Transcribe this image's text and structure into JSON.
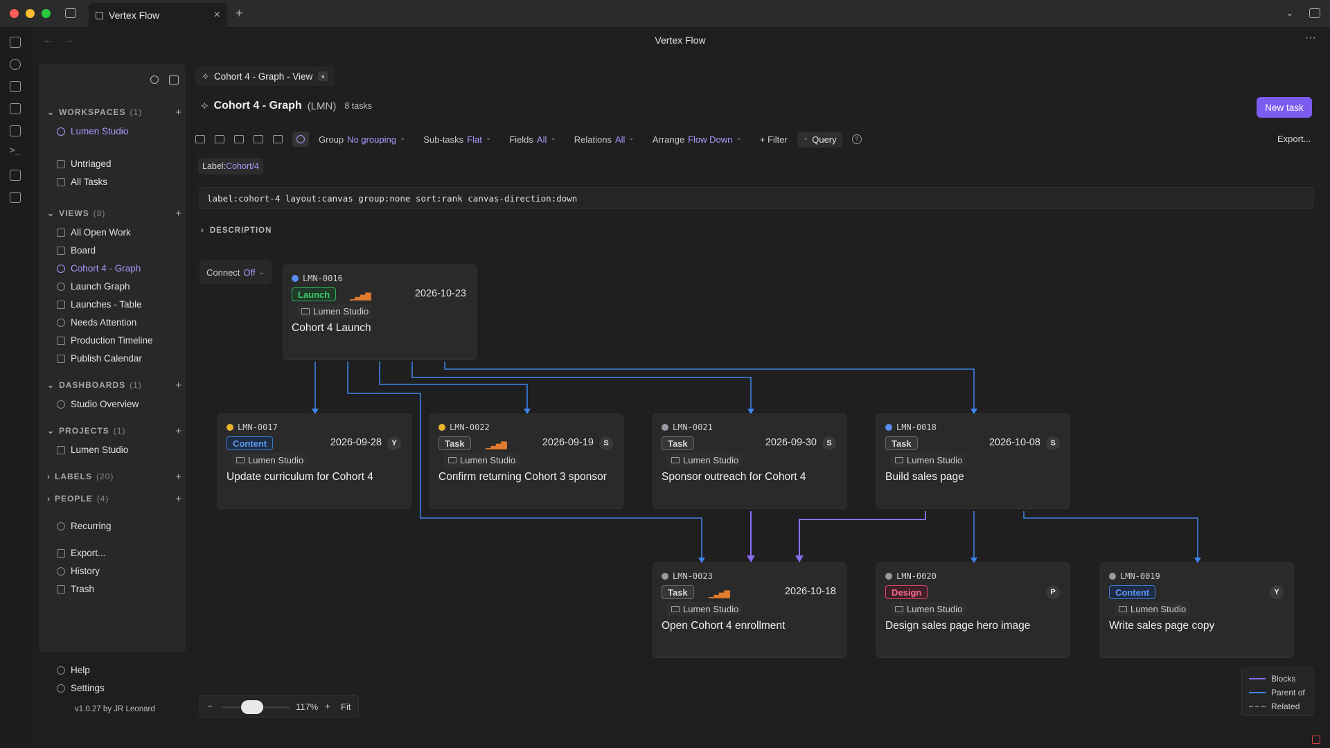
{
  "window": {
    "tab_title": "Vertex Flow",
    "app_title": "Vertex Flow"
  },
  "sidebar": {
    "workspaces": {
      "label": "WORKSPACES",
      "count": "(1)",
      "items": [
        "Lumen Studio"
      ]
    },
    "quick": [
      "Untriaged",
      "All Tasks"
    ],
    "views": {
      "label": "VIEWS",
      "count": "(8)",
      "items": [
        "All Open Work",
        "Board",
        "Cohort 4 - Graph",
        "Launch Graph",
        "Launches - Table",
        "Needs Attention",
        "Production Timeline",
        "Publish Calendar"
      ]
    },
    "dashboards": {
      "label": "DASHBOARDS",
      "count": "(1)",
      "items": [
        "Studio Overview"
      ]
    },
    "projects": {
      "label": "PROJECTS",
      "count": "(1)",
      "items": [
        "Lumen Studio"
      ]
    },
    "labels": {
      "label": "LABELS",
      "count": "(20)"
    },
    "people": {
      "label": "PEOPLE",
      "count": "(4)"
    },
    "misc": [
      "Recurring",
      "Export...",
      "History",
      "Trash"
    ],
    "footer": [
      "Help",
      "Settings"
    ],
    "version": "v1.0.27 by JR Leonard"
  },
  "view_tab": "Cohort 4 - Graph - View",
  "header": {
    "title": "Cohort 4 - Graph",
    "code": "(LMN)",
    "count": "8 tasks",
    "new_task": "New task"
  },
  "toolbar": {
    "group": {
      "label": "Group",
      "value": "No grouping"
    },
    "subtasks": {
      "label": "Sub-tasks",
      "value": "Flat"
    },
    "fields": {
      "label": "Fields",
      "value": "All"
    },
    "relations": {
      "label": "Relations",
      "value": "All"
    },
    "arrange": {
      "label": "Arrange",
      "value": "Flow Down"
    },
    "filter": "+ Filter",
    "query": "Query",
    "export": "Export..."
  },
  "label_chip": {
    "key": "Label:",
    "value": "Cohort/4"
  },
  "query_text": "label:cohort-4 layout:canvas group:none sort:rank canvas-direction:down",
  "description_label": "DESCRIPTION",
  "connect": {
    "label": "Connect",
    "value": "Off"
  },
  "cards": [
    {
      "id": "LMN-0016",
      "tag": "Launch",
      "tagclass": "tag-launch",
      "dot": "#5b8cf0",
      "prio": true,
      "date": "2026-10-23",
      "avatar": "",
      "project": "Lumen Studio",
      "title": "Cohort 4 Launch"
    },
    {
      "id": "LMN-0017",
      "tag": "Content",
      "tagclass": "tag-content",
      "dot": "#e8b52e",
      "prio": false,
      "date": "2026-09-28",
      "avatar": "Y",
      "project": "Lumen Studio",
      "title": "Update curriculum for Cohort 4"
    },
    {
      "id": "LMN-0022",
      "tag": "Task",
      "tagclass": "tag-task",
      "dot": "#e8b52e",
      "prio": true,
      "date": "2026-09-19",
      "avatar": "S",
      "project": "Lumen Studio",
      "title": "Confirm returning Cohort 3 sponsor"
    },
    {
      "id": "LMN-0021",
      "tag": "Task",
      "tagclass": "tag-task",
      "dot": "#9a9aa6",
      "prio": false,
      "date": "2026-09-30",
      "avatar": "S",
      "project": "Lumen Studio",
      "title": "Sponsor outreach for Cohort 4"
    },
    {
      "id": "LMN-0018",
      "tag": "Task",
      "tagclass": "tag-task",
      "dot": "#5b8cf0",
      "prio": false,
      "date": "2026-10-08",
      "avatar": "S",
      "project": "Lumen Studio",
      "title": "Build sales page"
    },
    {
      "id": "LMN-0023",
      "tag": "Task",
      "tagclass": "tag-task",
      "dot": "#9a9aa6",
      "prio": true,
      "date": "2026-10-18",
      "avatar": "",
      "project": "Lumen Studio",
      "title": "Open Cohort 4 enrollment"
    },
    {
      "id": "LMN-0020",
      "tag": "Design",
      "tagclass": "tag-design",
      "dot": "#9a9aa6",
      "prio": false,
      "date": "",
      "avatar": "P",
      "project": "Lumen Studio",
      "title": "Design sales page hero image"
    },
    {
      "id": "LMN-0019",
      "tag": "Content",
      "tagclass": "tag-content",
      "dot": "#9a9aa6",
      "prio": false,
      "date": "",
      "avatar": "Y",
      "project": "Lumen Studio",
      "title": "Write sales page copy"
    }
  ],
  "zoom": {
    "minus": "−",
    "level": "117%",
    "plus": "+",
    "fit": "Fit",
    "slider_value": 0.45
  },
  "legend": [
    {
      "label": "Blocks",
      "color": "#8a6cf5",
      "style": "solid"
    },
    {
      "label": "Parent of",
      "color": "#3f86f0",
      "style": "solid"
    },
    {
      "label": "Related",
      "color": "#777777",
      "style": "dashed"
    }
  ],
  "colors": {
    "accent": "#a89bff",
    "button": "#7c5cf0",
    "parent_edge": "#3f86f0",
    "blocks_edge": "#8a6cf5"
  }
}
